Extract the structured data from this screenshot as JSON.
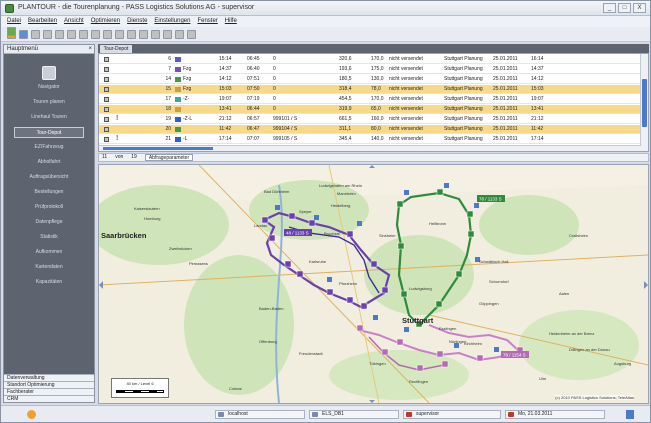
{
  "window": {
    "title": "PLANTOUR - die Tourenplanung - PASS Logistics Solutions AG - supervisor",
    "buttons": [
      "_",
      "□",
      "X"
    ]
  },
  "menu": [
    "Datei",
    "Bearbeiten",
    "Ansicht",
    "Optimieren",
    "Dienste",
    "Einstellungen",
    "Fenster",
    "Hilfe"
  ],
  "sidebar": {
    "header": "Hauptmenü",
    "items": [
      "Navigator",
      "Touren planen",
      "Linehaul Touren",
      "Tour-Depot",
      "EZ/Fahrzeug",
      "Abholfahrt",
      "Auftragsübersicht",
      "Bestellungen",
      "Prüfprotokoll",
      "Datenpflege",
      "Statistik",
      "Aufkommen",
      "Kartendaten",
      "Kapazitäten"
    ],
    "selected_index": 3,
    "bottom": [
      "Datenverwaltung",
      "Standort Optimierung",
      "Fachberater",
      "CRM"
    ]
  },
  "tab": {
    "label": "Tour-Depot"
  },
  "grid": {
    "rows": [
      {
        "flag": "",
        "n": "6",
        "color": "#5b5bd6",
        "type": "",
        "t1": "15:14",
        "t2": "06:45",
        "no": "0",
        "km": "320,6",
        "load": "170,0",
        "status": "nicht versendet",
        "planner": "Stuttgart Planung",
        "date": "25.01.2011",
        "t3": "16:14",
        "hl": false
      },
      {
        "flag": "",
        "n": "7",
        "color": "#7a4fb5",
        "type": "Fzg",
        "t1": "14:37",
        "t2": "06:40",
        "no": "0",
        "km": "193,6",
        "load": "175,0",
        "status": "nicht versendet",
        "planner": "Stuttgart Planung",
        "date": "25.01.2011",
        "t3": "14:37",
        "hl": false
      },
      {
        "flag": "",
        "n": "14",
        "color": "#3f9a4a",
        "type": "Fzg",
        "t1": "14:12",
        "t2": "07:51",
        "no": "0",
        "km": "180,5",
        "load": "130,0",
        "status": "nicht versendet",
        "planner": "Stuttgart Planung",
        "date": "25.01.2011",
        "t3": "14:12",
        "hl": false
      },
      {
        "flag": "",
        "n": "15",
        "color": "#c8a040",
        "type": "Fzg",
        "t1": "15:03",
        "t2": "07:50",
        "no": "0",
        "km": "318,4",
        "load": "78,0",
        "status": "nicht versendet",
        "planner": "Stuttgart Planung",
        "date": "25.01.2011",
        "t3": "15:03",
        "hl": true
      },
      {
        "flag": "",
        "n": "17",
        "color": "#3aa6a6",
        "type": "-Z-",
        "t1": "19:07",
        "t2": "07:19",
        "no": "0",
        "km": "454,5",
        "load": "170,0",
        "status": "nicht versendet",
        "planner": "Stuttgart Planung",
        "date": "25.01.2011",
        "t3": "19:07",
        "hl": false
      },
      {
        "flag": "",
        "n": "18",
        "color": "#c8a040",
        "type": "",
        "t1": "13:41",
        "t2": "06:44",
        "no": "0",
        "km": "319,9",
        "load": "65,0",
        "status": "nicht versendet",
        "planner": "Stuttgart Planung",
        "date": "25.01.2011",
        "t3": "13:41",
        "hl": true
      },
      {
        "flag": "!",
        "n": "19",
        "color": "#2d5fd0",
        "type": "-Z-L",
        "t1": "21:12",
        "t2": "06:57",
        "no": "999101 / S",
        "km": "661,5",
        "load": "160,0",
        "status": "nicht versendet",
        "planner": "Stuttgart Planung",
        "date": "25.01.2011",
        "t3": "21:12",
        "hl": false
      },
      {
        "flag": "",
        "n": "20",
        "color": "#3f9a4a",
        "type": "",
        "t1": "11:42",
        "t2": "06:47",
        "no": "999104 / S",
        "km": "311,1",
        "load": "80,0",
        "status": "nicht versendet",
        "planner": "Stuttgart Planung",
        "date": "25.01.2011",
        "t3": "11:42",
        "hl": true
      },
      {
        "flag": "!",
        "n": "21",
        "color": "#2d5fd0",
        "type": "-L",
        "t1": "17:14",
        "t2": "07:07",
        "no": "999105 / S",
        "km": "345,4",
        "load": "140,0",
        "status": "nicht versendet",
        "planner": "Stuttgart Planung",
        "date": "25.01.2011",
        "t3": "17:14",
        "hl": false
      }
    ]
  },
  "statusline": {
    "count": "11",
    "von": "von",
    "total": "19",
    "param": "Abfrageparameter"
  },
  "map": {
    "cities": [
      "Saarbrücken",
      "Stuttgart",
      "Bad Dürkheim",
      "Ludwigshafen am Rhein",
      "Heidelberg",
      "Mannheim",
      "Heilbronn",
      "Karlsruhe",
      "Pforzheim",
      "Baden-Baden",
      "Ludwigsburg",
      "Esslingen",
      "Tübingen",
      "Reutlingen",
      "Schwäbisch Hall",
      "Heidenheim an der Brenz",
      "Dillingen an der Donau",
      "Kaiserslautern",
      "Pirmasens",
      "Offenburg",
      "Göppingen",
      "Aalen",
      "Landau",
      "Speyer",
      "Bruchsal",
      "Sinsheim",
      "Schorndorf",
      "Kirchheim",
      "Homburg",
      "Zweibrücken",
      "Colmar",
      "Freudenstadt",
      "Ulm",
      "Augsburg",
      "Nürtingen",
      "Crailsheim"
    ],
    "route_labels": [
      "48 / 1133 S",
      "78 / 1133 S",
      "78 / 1154 S"
    ],
    "scale_label": "40 km / Level 6",
    "copyright": "(c) 2010 PASS Logistics Solutions; TeleAtlas"
  },
  "bottombar": {
    "host": "localhost",
    "db": "ELS_DB1",
    "user": "supervisor",
    "date": "Mo, 21.03.2011"
  },
  "colors": {
    "purple_route": "#6a3fb0",
    "green_route": "#2f8a3c",
    "pink_route": "#c880c8",
    "highlight_row": "#f7d98a"
  }
}
